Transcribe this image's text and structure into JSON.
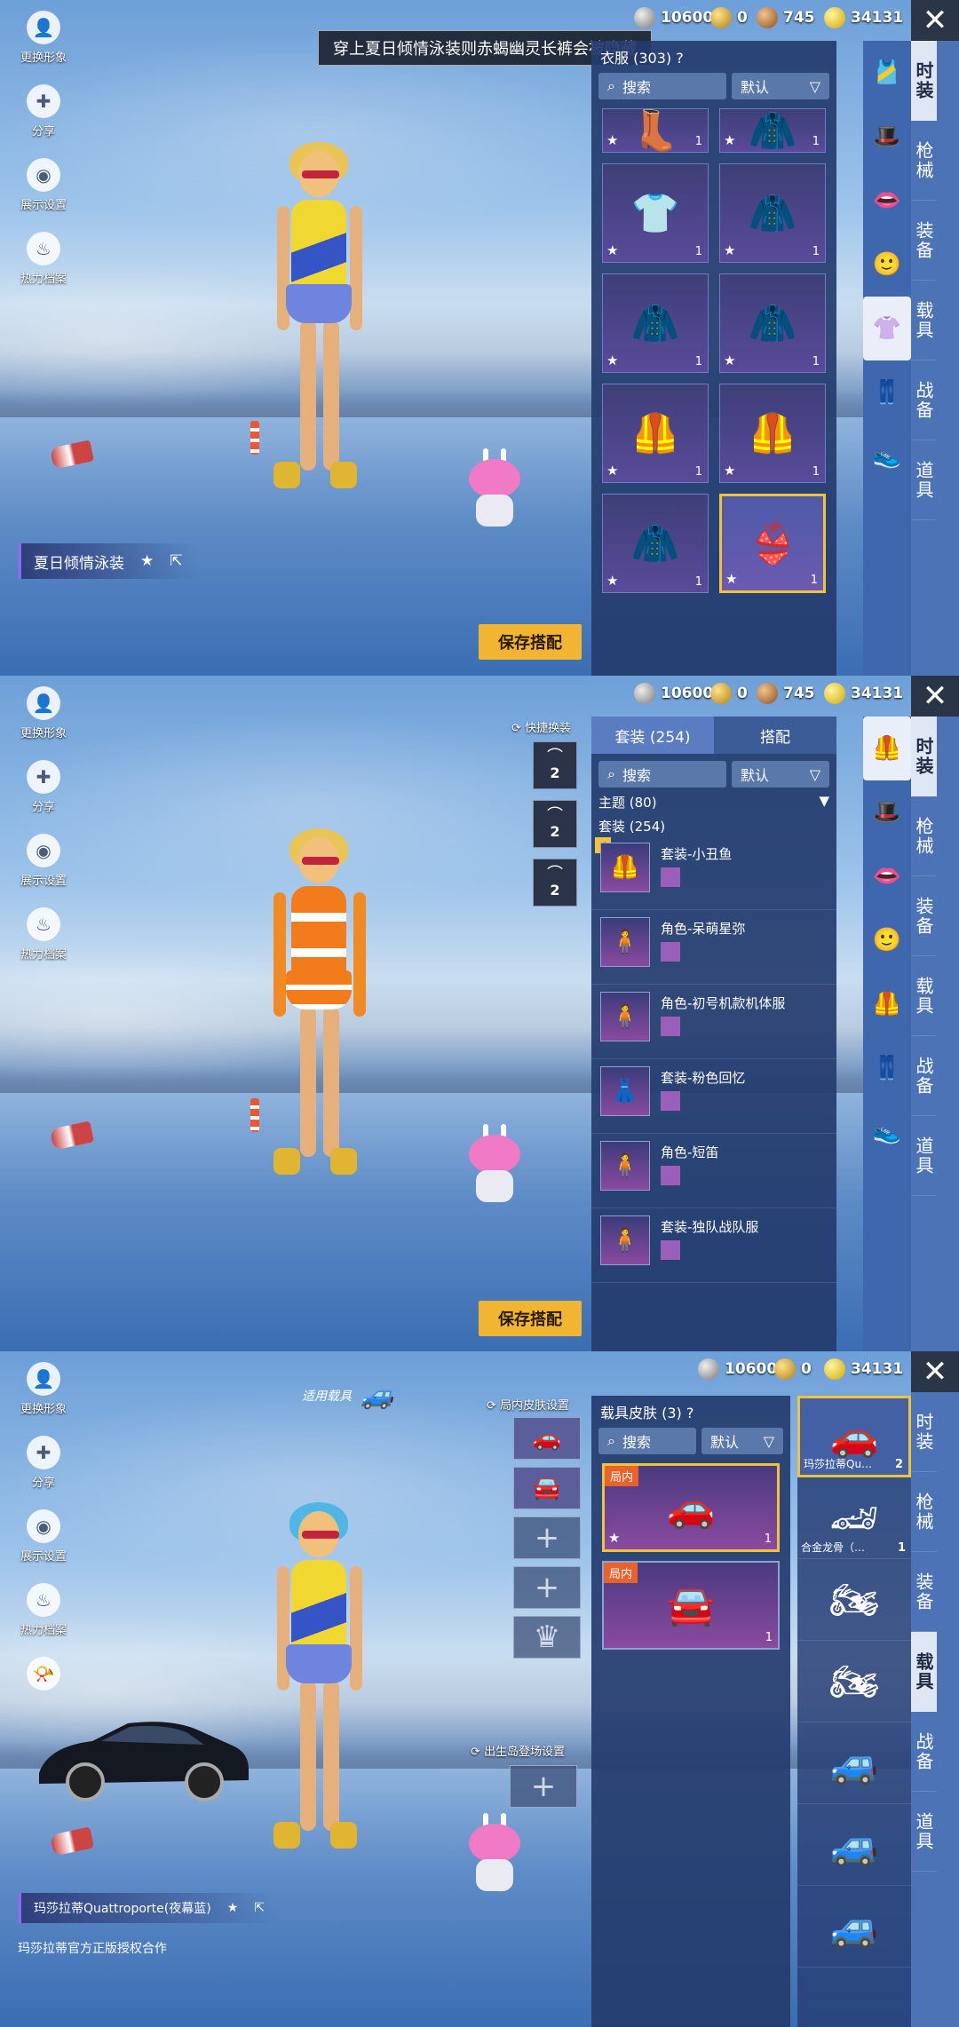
{
  "left_menu": [
    {
      "label": "更换形象",
      "icon": "avatar-icon"
    },
    {
      "label": "分享",
      "icon": "puzzle-icon"
    },
    {
      "label": "展示设置",
      "icon": "eye-icon"
    },
    {
      "label": "热力档案",
      "icon": "flame-icon"
    }
  ],
  "currency": {
    "silver": "10600",
    "gold_a": "0",
    "bronze": "745",
    "coupon": "34131"
  },
  "close_glyph": "✕",
  "right_tabs": [
    "时装",
    "枪械",
    "装备",
    "载具",
    "战备",
    "道具"
  ],
  "panel1": {
    "toast": "穿上夏日倾情泳装则赤蝎幽灵长裤会被隐藏",
    "list_title": "衣服 (303)",
    "help": "?",
    "search_placeholder": "搜索",
    "sort": "默认",
    "item_counts": [
      "1",
      "1",
      "1",
      "1",
      "1",
      "1",
      "1",
      "1",
      "1",
      "1"
    ],
    "outfit_name": "夏日倾情泳装",
    "save": "保存搭配"
  },
  "panel2": {
    "tab_suits": "套装 (254)",
    "tab_match": "搭配",
    "search_placeholder": "搜索",
    "sort": "默认",
    "theme": "主题 (80)",
    "suits_section": "套装 (254)",
    "quick_change": "快捷换装",
    "hanger_num": "2",
    "outfits": [
      {
        "label": "套装-小丑鱼",
        "checked": true
      },
      {
        "label": "角色-呆萌星弥",
        "checked": false
      },
      {
        "label": "角色-初号机款机体服",
        "checked": false
      },
      {
        "label": "套装-粉色回忆",
        "checked": false
      },
      {
        "label": "角色-短笛",
        "checked": false
      },
      {
        "label": "套装-独队战队服",
        "checked": false
      }
    ],
    "save": "保存搭配"
  },
  "panel3": {
    "usable_vehicle": "适用载具",
    "skin_title": "载具皮肤 (3)",
    "help": "?",
    "search_placeholder": "搜索",
    "sort": "默认",
    "tag_in_use": "局内",
    "skin_counts": [
      "1",
      "1"
    ],
    "skin_settings": "局内皮肤设置",
    "spawn_settings": "出生岛登场设置",
    "vehicle_list": [
      {
        "name": "玛莎拉蒂Qu…",
        "count": "2"
      },
      {
        "name": "合金龙骨（…",
        "count": "1"
      },
      {
        "name": "",
        "count": ""
      },
      {
        "name": "",
        "count": ""
      },
      {
        "name": "",
        "count": ""
      },
      {
        "name": "",
        "count": ""
      },
      {
        "name": "",
        "count": ""
      }
    ],
    "vehicle_name": "玛莎拉蒂Quattroporte(夜幕蓝)",
    "partner_note": "玛莎拉蒂官方正版授权合作"
  }
}
